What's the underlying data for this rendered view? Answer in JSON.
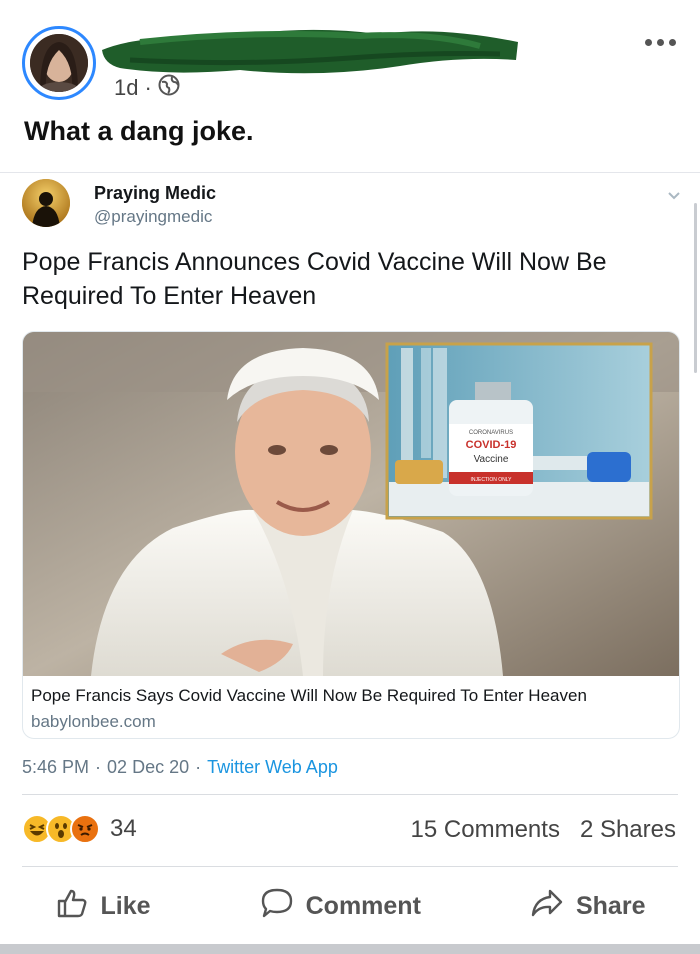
{
  "post": {
    "timestamp": "1d",
    "visibility_icon": "globe-icon",
    "more_icon": "more-horizontal-icon",
    "caption": "What a dang joke."
  },
  "tweet": {
    "name": "Praying Medic",
    "handle": "@prayingmedic",
    "text": "Pope Francis Announces Covid Vaccine Will Now Be Required To Enter Heaven",
    "link": {
      "title": "Pope Francis Says Covid Vaccine Will Now Be Required To Enter Heaven",
      "domain": "babylonbee.com",
      "image_text": {
        "top": "CORONAVIRUS",
        "name": "COVID-19",
        "sub": "Vaccine",
        "bottom": "INJECTION ONLY"
      }
    },
    "time": "5:46 PM",
    "sep": "·",
    "date": "02 Dec 20",
    "app": "Twitter Web App"
  },
  "reactions": {
    "icons": [
      "haha-icon",
      "wow-icon",
      "angry-icon"
    ],
    "count": "34",
    "comments": "15 Comments",
    "shares": "2 Shares"
  },
  "actions": {
    "like": "Like",
    "comment": "Comment",
    "share": "Share"
  },
  "colors": {
    "accent": "#2d88ff",
    "twitter_link": "#1b95e0",
    "muted": "#657786"
  }
}
